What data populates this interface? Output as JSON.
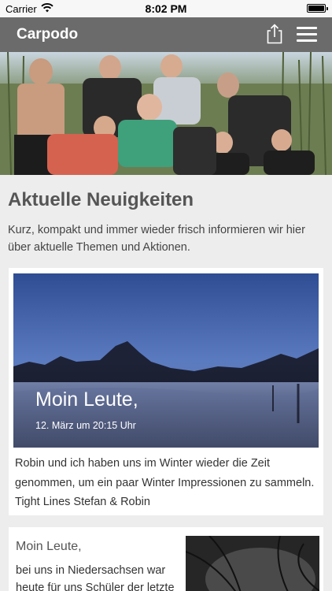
{
  "status_bar": {
    "carrier": "Carrier",
    "time": "8:02 PM",
    "battery_level": 1.0
  },
  "nav": {
    "title": "Carpodo",
    "share_icon": "share-icon",
    "menu_icon": "hamburger-menu-icon"
  },
  "page": {
    "heading": "Aktuelle Neuigkeiten",
    "intro": "Kurz, kompakt und immer wieder frisch informieren wir hier über aktuelle Themen und Aktionen."
  },
  "posts": [
    {
      "title": "Moin Leute,",
      "date": "12. März um 20:15 Uhr",
      "body": "Robin und ich haben uns im Winter wieder die Zeit genommen, um ein paar Winter Impressionen zu sammeln. Tight Lines Stefan & Robin"
    },
    {
      "title": "Moin Leute,",
      "excerpt": "bei uns in Niedersachsen war heute für uns Schüler der letzte"
    }
  ],
  "colors": {
    "nav_bar": "#6b6b6b",
    "background": "#ededed",
    "card": "#ffffff"
  }
}
